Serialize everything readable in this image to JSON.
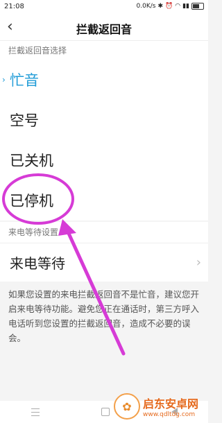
{
  "status_bar": {
    "time": "21:08",
    "network_speed": "0.0K/s",
    "icons": [
      "bluetooth-icon",
      "alarm-icon",
      "wifi-icon",
      "signal-icon",
      "battery-icon"
    ]
  },
  "header": {
    "title": "拦截返回音",
    "back_icon": "back-arrow-icon"
  },
  "section1": {
    "label": "拦截返回音选择",
    "options": [
      {
        "label": "忙音",
        "selected": true
      },
      {
        "label": "空号",
        "selected": false
      },
      {
        "label": "已关机",
        "selected": false
      },
      {
        "label": "已停机",
        "selected": false
      }
    ],
    "selected_mark": "›"
  },
  "section2": {
    "label": "来电等待设置",
    "item": "来电等待"
  },
  "description": "如果您设置的来电拦截返回音不是忙音，建议您开启来电等待功能。避免您正在通话时，第三方呼入电话听到您设置的拦截返回音，造成不必要的误会。",
  "nav_bar": [
    "menu-icon",
    "home-icon",
    "back-icon"
  ],
  "watermark": {
    "title": "启东安卓网",
    "url": "www.qdltdg.com"
  },
  "colors": {
    "accent": "#1e9bd7",
    "annotation": "#d63bd6",
    "watermark": "#e56a1e"
  }
}
